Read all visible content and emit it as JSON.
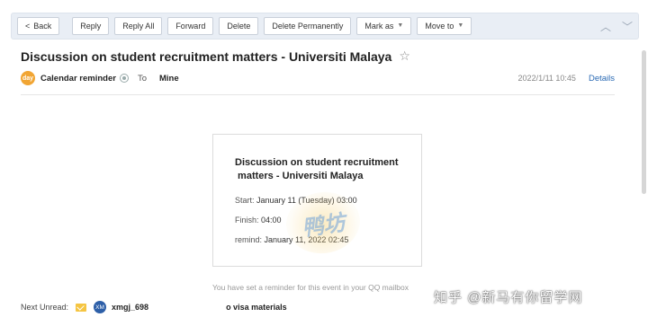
{
  "toolbar": {
    "back": "Back",
    "reply": "Reply",
    "reply_all": "Reply All",
    "forward": "Forward",
    "delete": "Delete",
    "delete_permanently": "Delete Permanently",
    "mark_as": "Mark as",
    "move_to": "Move to",
    "prev_icon": "chevron-up-icon",
    "next_icon": "chevron-down-icon"
  },
  "email": {
    "subject": "Discussion on student recruitment matters - Universiti Malaya",
    "sender_avatar": "day",
    "sender": "Calendar reminder",
    "to_label": "To",
    "recipient": "Mine",
    "date": "2022/1/11 10:45",
    "details": "Details"
  },
  "card": {
    "title_line1": "Discussion on student recruitment",
    "title_line2": " matters - Universiti Malaya",
    "start_label": "Start:",
    "start_value": "January 11 (Tuesday) 03:00",
    "finish_label": "Finish:",
    "finish_value": "04:00",
    "remind_label": "remind:",
    "remind_value": "January 11, 2022 02:45"
  },
  "reminder_note": "You have set a reminder for this event in your QQ mailbox",
  "next_unread": {
    "label": "Next Unread:",
    "badge": "XM",
    "from": "xmgj_698",
    "subject": "o visa materials"
  },
  "watermarks": {
    "stamp": "鸭坊",
    "site": "知乎 @新马有你留学网"
  },
  "colors": {
    "accent": "#2a6ab4",
    "toolbar_bg": "#e9eef5",
    "avatar": "#f1a533"
  }
}
